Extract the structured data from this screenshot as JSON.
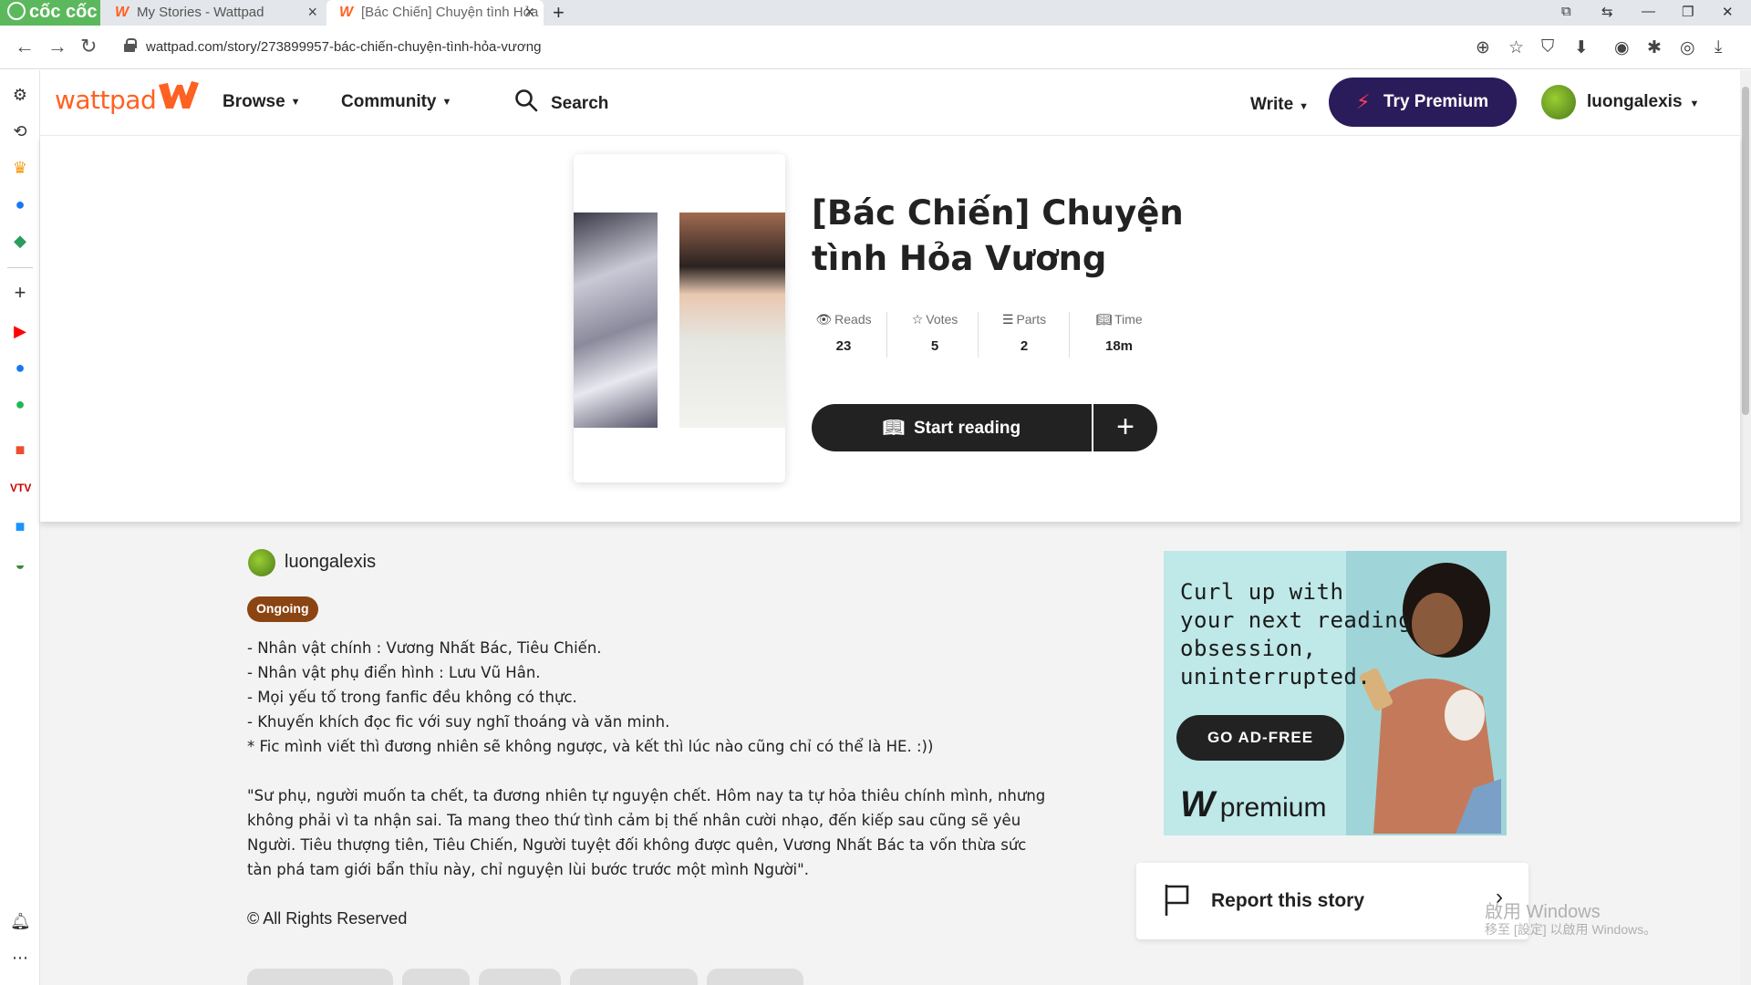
{
  "browser": {
    "brand": "cốc cốc",
    "tabs": [
      {
        "label": "My Stories - Wattpad"
      },
      {
        "label": "[Bác Chiến] Chuyện tình Hỏa"
      }
    ],
    "url": "wattpad.com/story/273899957-bác-chiến-chuyện-tình-hỏa-vương"
  },
  "header": {
    "logo": "wattpad",
    "nav": [
      {
        "label": "Browse"
      },
      {
        "label": "Community"
      }
    ],
    "search_label": "Search",
    "write_label": "Write",
    "premium_label": "Try Premium",
    "username": "luongalexis"
  },
  "story": {
    "title": "[Bác Chiến] Chuyện tình Hỏa Vương",
    "stats": [
      {
        "label": "Reads",
        "value": "23",
        "icon": "eye-icon"
      },
      {
        "label": "Votes",
        "value": "5",
        "icon": "star-icon"
      },
      {
        "label": "Parts",
        "value": "2",
        "icon": "list-icon"
      },
      {
        "label": "Time",
        "value": "18m",
        "icon": "book-icon"
      }
    ],
    "start_label": "Start reading",
    "add_label": "+",
    "author": "luongalexis",
    "status": "Ongoing",
    "description_lines": [
      "- Nhân vật chính : Vương Nhất Bác, Tiêu Chiến.",
      "- Nhân vật phụ điển hình : Lưu Vũ Hân.",
      "- Mọi yếu tố trong fanfic đều không có thực.",
      "- Khuyến khích đọc fic với suy nghĩ thoáng và văn minh.",
      "* Fic mình viết thì đương nhiên sẽ không ngược, và kết thì lúc nào cũng chỉ có thể là HE. :))"
    ],
    "quote_lines": [
      "\"Sư phụ, người muốn ta chết, ta đương nhiên tự nguyện chết. Hôm nay ta tự hỏa thiêu chính mình, nhưng",
      "không phải vì ta nhận sai. Ta mang theo thứ tình cảm bị thế nhân cười nhạo, đến kiếp sau cũng sẽ yêu",
      "Người. Tiêu thượng tiên, Tiêu Chiến, Người tuyệt đối không được quên, Vương Nhất Bác ta vốn thừa sức",
      "tàn phá tam giới bẩn thỉu này, chỉ nguyện lùi bước trước một mình Người\"."
    ],
    "copyright": "© All Rights Reserved"
  },
  "ad": {
    "headline_lines": [
      "Curl up with",
      "your next reading",
      "obsession,",
      "uninterrupted."
    ],
    "button": "GO AD-FREE",
    "brand": "premium"
  },
  "report_label": "Report this story",
  "watermark": {
    "line1": "啟用 Windows",
    "line2": "移至 [設定] 以啟用 Windows。"
  },
  "colors": {
    "brand": "#ff6122",
    "premium_bg": "#2a1c5a",
    "status_badge": "#8b4513",
    "content_bg": "#f3f3f3"
  }
}
